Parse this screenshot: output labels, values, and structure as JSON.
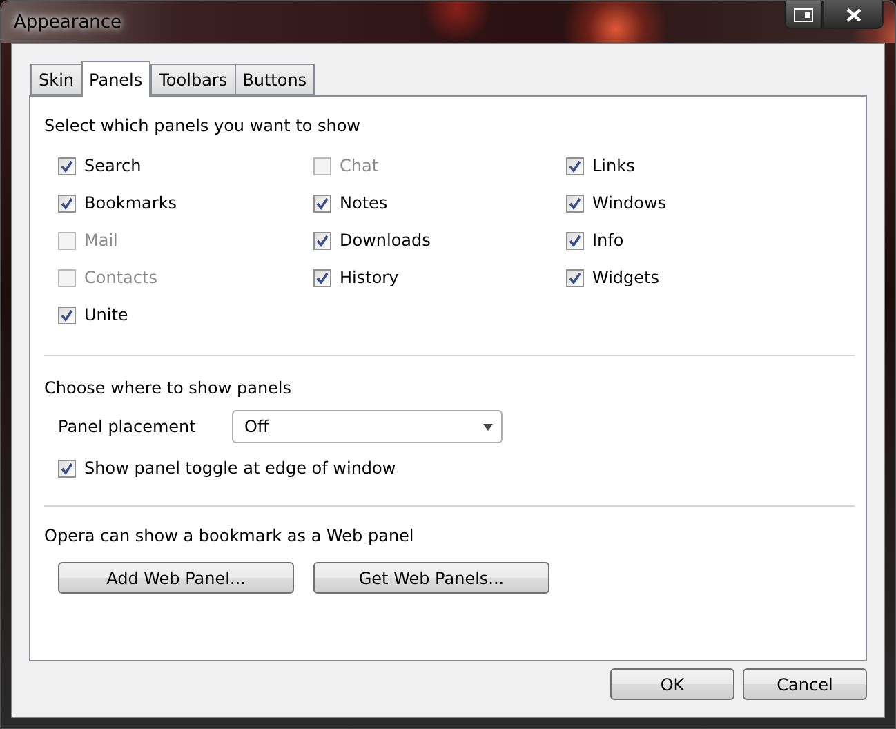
{
  "window": {
    "title": "Appearance"
  },
  "tabs": [
    {
      "label": "Skin",
      "selected": false
    },
    {
      "label": "Panels",
      "selected": true
    },
    {
      "label": "Toolbars",
      "selected": false
    },
    {
      "label": "Buttons",
      "selected": false
    }
  ],
  "panels_section": {
    "heading": "Select which panels you want to show",
    "panels": [
      {
        "label": "Search",
        "checked": true,
        "disabled": false
      },
      {
        "label": "Chat",
        "checked": false,
        "disabled": true
      },
      {
        "label": "Links",
        "checked": true,
        "disabled": false
      },
      {
        "label": "Bookmarks",
        "checked": true,
        "disabled": false
      },
      {
        "label": "Notes",
        "checked": true,
        "disabled": false
      },
      {
        "label": "Windows",
        "checked": true,
        "disabled": false
      },
      {
        "label": "Mail",
        "checked": false,
        "disabled": true
      },
      {
        "label": "Downloads",
        "checked": true,
        "disabled": false
      },
      {
        "label": "Info",
        "checked": true,
        "disabled": false
      },
      {
        "label": "Contacts",
        "checked": false,
        "disabled": true
      },
      {
        "label": "History",
        "checked": true,
        "disabled": false
      },
      {
        "label": "Widgets",
        "checked": true,
        "disabled": false
      },
      {
        "label": "Unite",
        "checked": true,
        "disabled": false
      }
    ]
  },
  "placement_section": {
    "heading": "Choose where to show panels",
    "placement_label": "Panel placement",
    "placement_value": "Off",
    "toggle": {
      "label": "Show panel toggle at edge of window",
      "checked": true
    }
  },
  "web_panel_section": {
    "heading": "Opera can show a bookmark as a Web panel",
    "buttons": [
      "Add Web Panel...",
      "Get Web Panels..."
    ]
  },
  "buttons": [
    "OK",
    "Cancel"
  ]
}
